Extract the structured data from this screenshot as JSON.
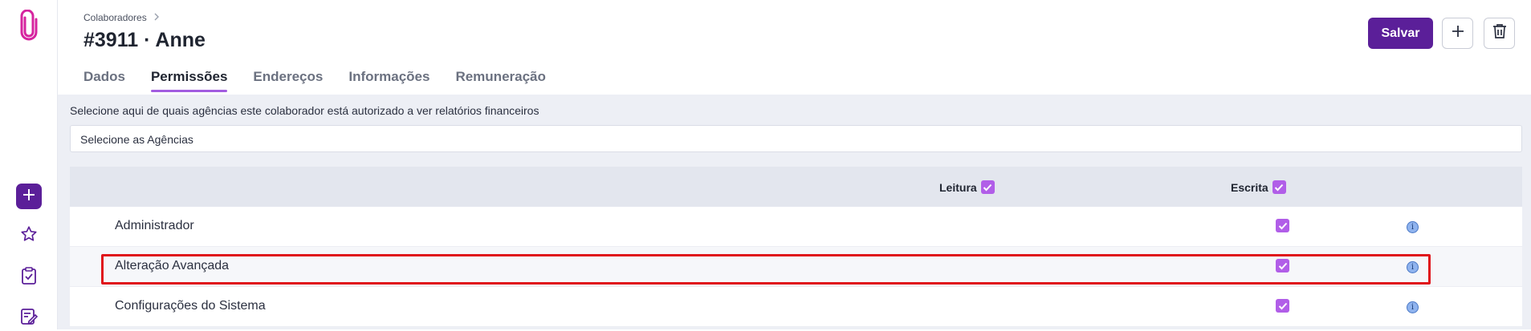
{
  "breadcrumb": {
    "label": "Colaboradores"
  },
  "page": {
    "title": "#3911 · Anne"
  },
  "header": {
    "save_label": "Salvar"
  },
  "tabs": [
    {
      "label": "Dados"
    },
    {
      "label": "Permissões"
    },
    {
      "label": "Endereços"
    },
    {
      "label": "Informações"
    },
    {
      "label": "Remuneração"
    }
  ],
  "active_tab": "Permissões",
  "content": {
    "description": "Selecione aqui de quais agências este colaborador está autorizado a ver relatórios financeiros",
    "agencias_placeholder": "Selecione as Agências"
  },
  "table": {
    "columns": [
      {
        "label": "Leitura",
        "checked": true
      },
      {
        "label": "Escrita",
        "checked": true
      }
    ],
    "rows": [
      {
        "label": "Administrador",
        "escrita": true
      },
      {
        "label": "Alteração Avançada",
        "escrita": true,
        "highlighted": true
      },
      {
        "label": "Configurações do Sistema",
        "escrita": true
      }
    ]
  },
  "icons": {
    "logo": "paperclip-logo-icon",
    "sidebar": [
      "plus-icon",
      "star-icon",
      "clipboard-check-icon",
      "edit-list-icon"
    ],
    "header": [
      "plus-icon",
      "trash-icon"
    ],
    "row_info": "info-icon"
  },
  "colors": {
    "primary": "#5b1f99",
    "checkbox": "#b15ee8",
    "accent_tab": "#a25ce0",
    "highlight": "#e0141b",
    "logo": "#d6249f"
  }
}
